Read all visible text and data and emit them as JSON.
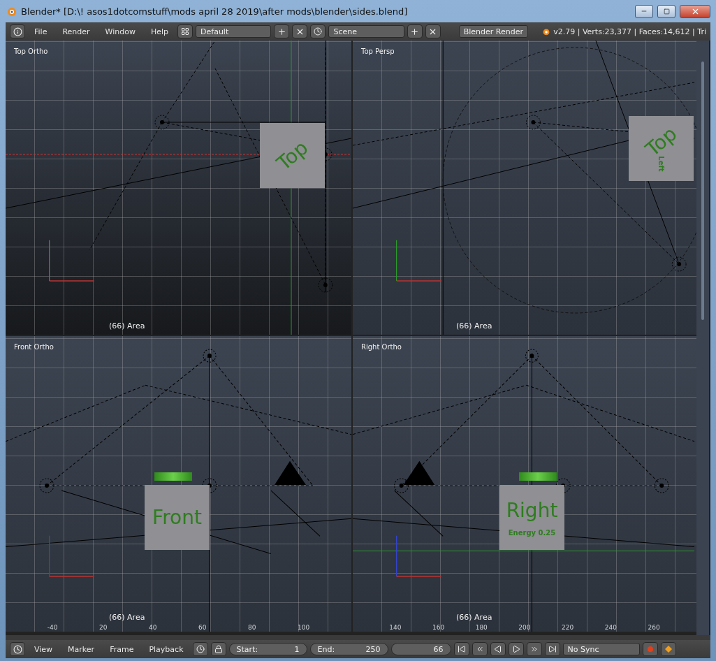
{
  "window": {
    "title": "Blender* [D:\\! asos1dotcomstuff\\mods april 28 2019\\after mods\\blender\\sides.blend]"
  },
  "header": {
    "menus": [
      "File",
      "Render",
      "Window",
      "Help"
    ],
    "layout": "Default",
    "scene": "Scene",
    "engine": "Blender Render",
    "stats": "v2.79 | Verts:23,377 | Faces:14,612 | Tri"
  },
  "viewports": [
    {
      "kind": "top",
      "label": "Top Ortho",
      "status": "(66) Area",
      "cube_texts": [
        "Top"
      ]
    },
    {
      "kind": "persp",
      "label": "Top Persp",
      "status": "(66) Area",
      "cube_texts": [
        "Top",
        "Left"
      ]
    },
    {
      "kind": "front",
      "label": "Front Ortho",
      "status": "(66) Area",
      "cube_texts": [
        "Front"
      ],
      "ruler": [
        "-40",
        "20",
        "40",
        "60",
        "80",
        "100"
      ]
    },
    {
      "kind": "right",
      "label": "Right Ortho",
      "status": "(66) Area",
      "cube_texts": [
        "Right",
        "Energy 0.25"
      ],
      "ruler": [
        "140",
        "160",
        "180",
        "200",
        "220",
        "240",
        "260"
      ]
    }
  ],
  "timeline": {
    "menus": [
      "View",
      "Marker",
      "Frame",
      "Playback"
    ],
    "start_label": "Start:",
    "start": "1",
    "end_label": "End:",
    "end": "250",
    "frame": "66",
    "sync": "No Sync"
  }
}
